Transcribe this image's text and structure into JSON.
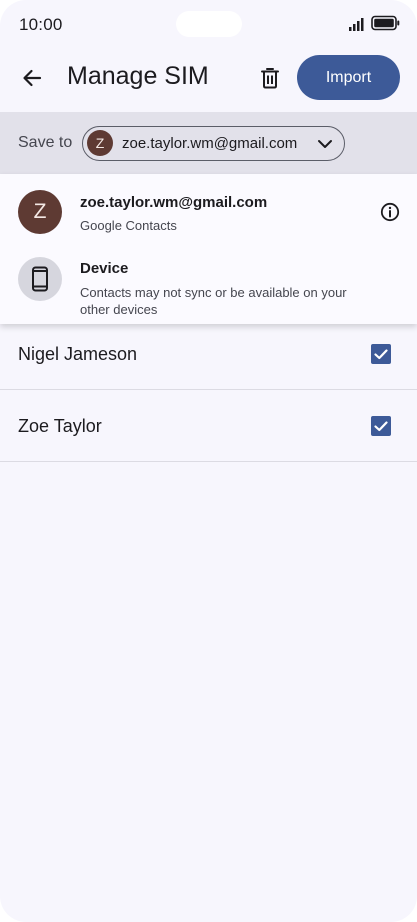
{
  "status_bar": {
    "time": "10:00"
  },
  "app_bar": {
    "title": "Manage SIM",
    "import_label": "Import"
  },
  "save_to": {
    "label": "Save to",
    "avatar_letter": "Z",
    "account": "zoe.taylor.wm@gmail.com"
  },
  "dropdown": {
    "options": [
      {
        "avatar_letter": "Z",
        "title": "zoe.taylor.wm@gmail.com",
        "subtitle": "Google Contacts"
      },
      {
        "title": "Device",
        "subtitle": "Contacts may not sync or be available on your other devices"
      }
    ]
  },
  "contacts": [
    {
      "name": "Nigel Jameson",
      "checked": true
    },
    {
      "name": "Zoe Taylor",
      "checked": true
    }
  ],
  "colors": {
    "accent": "#3d5a98",
    "avatar_bg": "#5e3a33",
    "background": "#f7f6fd"
  }
}
